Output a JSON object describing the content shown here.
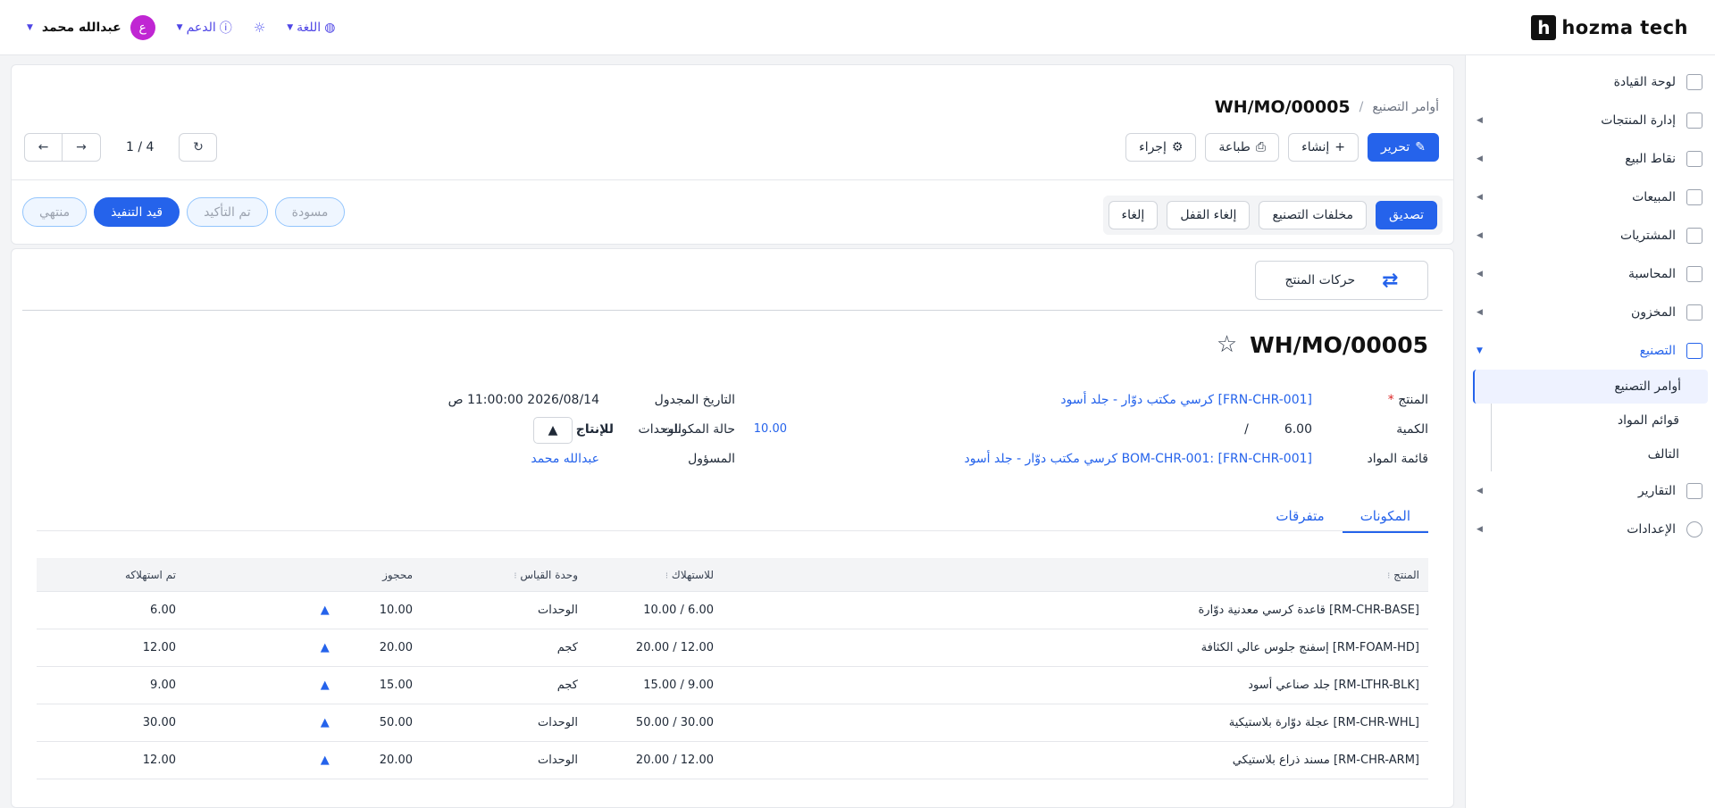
{
  "header": {
    "logo_letter": "h",
    "logo_text": "hozma tech",
    "language": "اللغة",
    "support": "الدعم",
    "user_name": "عبدالله محمد",
    "user_initial": "ع"
  },
  "sidebar": {
    "items": [
      {
        "label": "لوحة القيادة",
        "icon": "dashboard-icon"
      },
      {
        "label": "إدارة المنتجات",
        "icon": "tag-icon"
      },
      {
        "label": "نقاط البيع",
        "icon": "store-icon"
      },
      {
        "label": "المبيعات",
        "icon": "chart-line-icon"
      },
      {
        "label": "المشتريات",
        "icon": "box-icon"
      },
      {
        "label": "المحاسبة",
        "icon": "calculator-icon"
      },
      {
        "label": "المخزون",
        "icon": "cube-icon"
      },
      {
        "label": "التصنيع",
        "icon": "factory-icon"
      },
      {
        "label": "التقارير",
        "icon": "report-icon"
      },
      {
        "label": "الإعدادات",
        "icon": "gear-icon"
      }
    ],
    "sub_items": [
      "أوامر التصنيع",
      "قوائم المواد",
      "التالف"
    ]
  },
  "breadcrumb": {
    "parent": "أوامر التصنيع",
    "current": "WH/MO/00005"
  },
  "toolbar": {
    "edit": "تحرير",
    "create": "إنشاء",
    "print": "طباعة",
    "action": "إجراء"
  },
  "pager": {
    "count": "1 / 4"
  },
  "status_actions": {
    "confirm": "تصديق",
    "scrap": "مخلفات التصنيع",
    "unlock": "إلغاء القفل",
    "cancel": "إلغاء"
  },
  "steps": {
    "draft": "مسودة",
    "confirmed": "تم التأكيد",
    "in_progress": "قيد التنفيذ",
    "done": "منتهي"
  },
  "record": {
    "movements_label": "حركات المنتج",
    "title": "WH/MO/00005",
    "product_label": "المنتج",
    "product_value": "[FRN-CHR-001] كرسي مكتب دوّار - جلد أسود",
    "qty_label": "الكمية",
    "qty_value": "6.00",
    "qty_sep": "/",
    "qty_total": "10.00",
    "qty_unit": "الوحدات",
    "bom_label": "قائمة المواد",
    "bom_value": "BOM-CHR-001: [FRN-CHR-001] كرسي مكتب دوّار - جلد أسود",
    "scheduled_label": "التاريخ المجدول",
    "scheduled_value": "2026/08/14 11:00:00 ص",
    "component_status_label": "حالة المكونات",
    "component_status_value": "للإنتاج",
    "responsible_label": "المسؤول",
    "responsible_value": "عبدالله محمد"
  },
  "tabs": {
    "components": "المكونات",
    "misc": "متفرقات"
  },
  "table": {
    "headers": {
      "product": "المنتج",
      "to_consume": "للاستهلاك",
      "uom": "وحدة القياس",
      "reserved": "محجوز",
      "consumed": "تم استهلاكه"
    },
    "rows": [
      {
        "product": "[RM-CHR-BASE] قاعدة كرسي معدنية دوّارة",
        "to_consume": "10.00 / 6.00",
        "uom": "الوحدات",
        "reserved": "10.00",
        "consumed": "6.00"
      },
      {
        "product": "[RM-FOAM-HD] إسفنج جلوس عالي الكثافة",
        "to_consume": "20.00 / 12.00",
        "uom": "كجم",
        "reserved": "20.00",
        "consumed": "12.00"
      },
      {
        "product": "[RM-LTHR-BLK] جلد صناعي أسود",
        "to_consume": "15.00 / 9.00",
        "uom": "كجم",
        "reserved": "15.00",
        "consumed": "9.00"
      },
      {
        "product": "[RM-CHR-WHL] عجلة دوّارة بلاستيكية",
        "to_consume": "50.00 / 30.00",
        "uom": "الوحدات",
        "reserved": "50.00",
        "consumed": "30.00"
      },
      {
        "product": "[RM-CHR-ARM] مسند ذراع بلاستيكي",
        "to_consume": "20.00 / 12.00",
        "uom": "الوحدات",
        "reserved": "20.00",
        "consumed": "12.00"
      }
    ]
  }
}
